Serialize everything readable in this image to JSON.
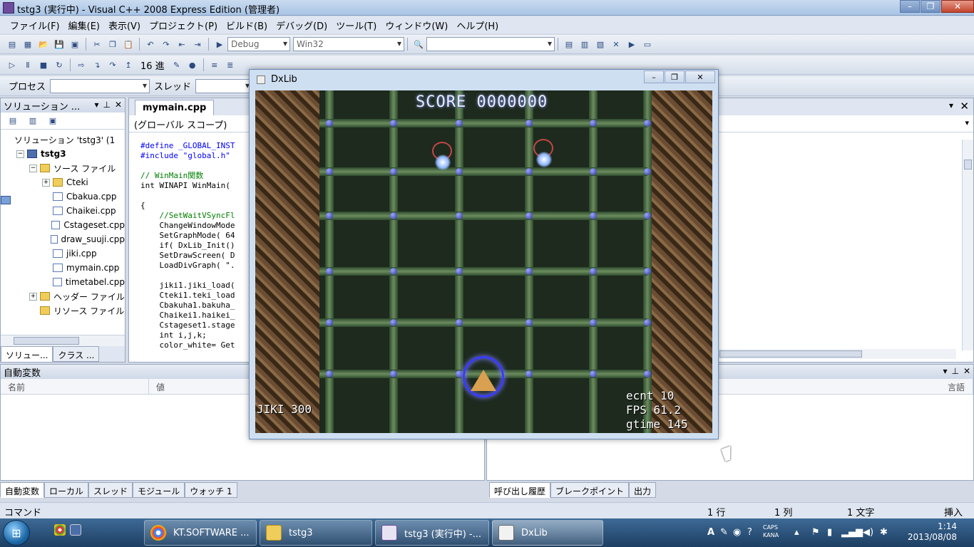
{
  "window": {
    "title": "tstg3 (実行中) - Visual C++ 2008 Express Edition (管理者)",
    "minimize": "–",
    "maximize": "❐",
    "close": "✕"
  },
  "menu": [
    "ファイル(F)",
    "編集(E)",
    "表示(V)",
    "プロジェクト(P)",
    "ビルド(B)",
    "デバッグ(D)",
    "ツール(T)",
    "ウィンドウ(W)",
    "ヘルプ(H)"
  ],
  "toolbar": {
    "config": "Debug",
    "platform": "Win32",
    "hex_label": "16 進",
    "process_label": "プロセス",
    "thread_label": "スレッド"
  },
  "solution_explorer": {
    "title": "ソリューション ...",
    "items": [
      {
        "label": "ソリューション 'tstg3' (1",
        "type": "sol",
        "indent": 0,
        "expander": ""
      },
      {
        "label": "tstg3",
        "type": "proj",
        "indent": 1,
        "expander": "−"
      },
      {
        "label": "ソース ファイル",
        "type": "folder",
        "indent": 2,
        "expander": "−"
      },
      {
        "label": "Cteki",
        "type": "folder",
        "indent": 3,
        "expander": "+"
      },
      {
        "label": "Cbakua.cpp",
        "type": "cpp",
        "indent": 3,
        "expander": ""
      },
      {
        "label": "Chaikei.cpp",
        "type": "cpp",
        "indent": 3,
        "expander": ""
      },
      {
        "label": "Cstageset.cpp",
        "type": "cpp",
        "indent": 3,
        "expander": ""
      },
      {
        "label": "draw_suuji.cpp",
        "type": "cpp",
        "indent": 3,
        "expander": ""
      },
      {
        "label": "jiki.cpp",
        "type": "cpp",
        "indent": 3,
        "expander": ""
      },
      {
        "label": "mymain.cpp",
        "type": "cpp",
        "indent": 3,
        "expander": ""
      },
      {
        "label": "timetabel.cpp",
        "type": "cpp",
        "indent": 3,
        "expander": ""
      },
      {
        "label": "ヘッダー ファイル",
        "type": "folder",
        "indent": 2,
        "expander": "+"
      },
      {
        "label": "リソース ファイル",
        "type": "folder",
        "indent": 2,
        "expander": ""
      }
    ],
    "tabs": [
      "ソリュー...",
      "クラス ..."
    ]
  },
  "editor": {
    "tab": "mymain.cpp",
    "scope": "(グローバル スコープ)",
    "code_lines": [
      {
        "t": "#define _GLOBAL_INST",
        "c": "kw"
      },
      {
        "t": "#include \"global.h\"",
        "c": "kw"
      },
      {
        "t": "",
        "c": ""
      },
      {
        "t": "// WinMain関数",
        "c": "cm"
      },
      {
        "t": "int WINAPI WinMain(",
        "c": ""
      },
      {
        "t": "",
        "c": ""
      },
      {
        "t": "{",
        "c": ""
      },
      {
        "t": "    //SetWaitVSyncFl",
        "c": "cm"
      },
      {
        "t": "    ChangeWindowMode",
        "c": ""
      },
      {
        "t": "    SetGraphMode( 64",
        "c": ""
      },
      {
        "t": "    if( DxLib_Init()",
        "c": ""
      },
      {
        "t": "    SetDrawScreen( D",
        "c": ""
      },
      {
        "t": "    LoadDivGraph( \".",
        "c": ""
      },
      {
        "t": "",
        "c": ""
      },
      {
        "t": "    jiki1.jiki_load(",
        "c": ""
      },
      {
        "t": "    Cteki1.teki_load",
        "c": ""
      },
      {
        "t": "    Cbakuha1.bakuha_",
        "c": ""
      },
      {
        "t": "    Chaikei1.haikei_",
        "c": ""
      },
      {
        "t": "    Cstageset1.stage",
        "c": ""
      },
      {
        "t": "    int i,j,k;",
        "c": ""
      },
      {
        "t": "    color_white= Get",
        "c": ""
      }
    ]
  },
  "autos": {
    "title": "自動変数",
    "col_name": "名前",
    "col_value": "値",
    "col_lang": "言語"
  },
  "bottom_tabs_left": [
    "自動変数",
    "ローカル",
    "スレッド",
    "モジュール",
    "ウォッチ 1"
  ],
  "bottom_tabs_right": [
    "呼び出し履歴",
    "ブレークポイント",
    "出力"
  ],
  "status": {
    "left": "コマンド",
    "line": "1 行",
    "col": "1 列",
    "chars": "1 文字",
    "mode": "挿入"
  },
  "dxlib": {
    "title": "DxLib",
    "score": "SCORE 0000000",
    "jiki": "JIKI 300",
    "ecnt": "ecnt 10",
    "fps": "FPS 61.2",
    "gtime": "gtime 145"
  },
  "taskbar": {
    "tasks": [
      "KT.SOFTWARE ...",
      "tstg3",
      "tstg3 (実行中) -...",
      "DxLib"
    ],
    "time": "1:14",
    "date": "2013/08/08",
    "caps": "CAPS",
    "kana": "KANA",
    "ime_a": "A"
  }
}
